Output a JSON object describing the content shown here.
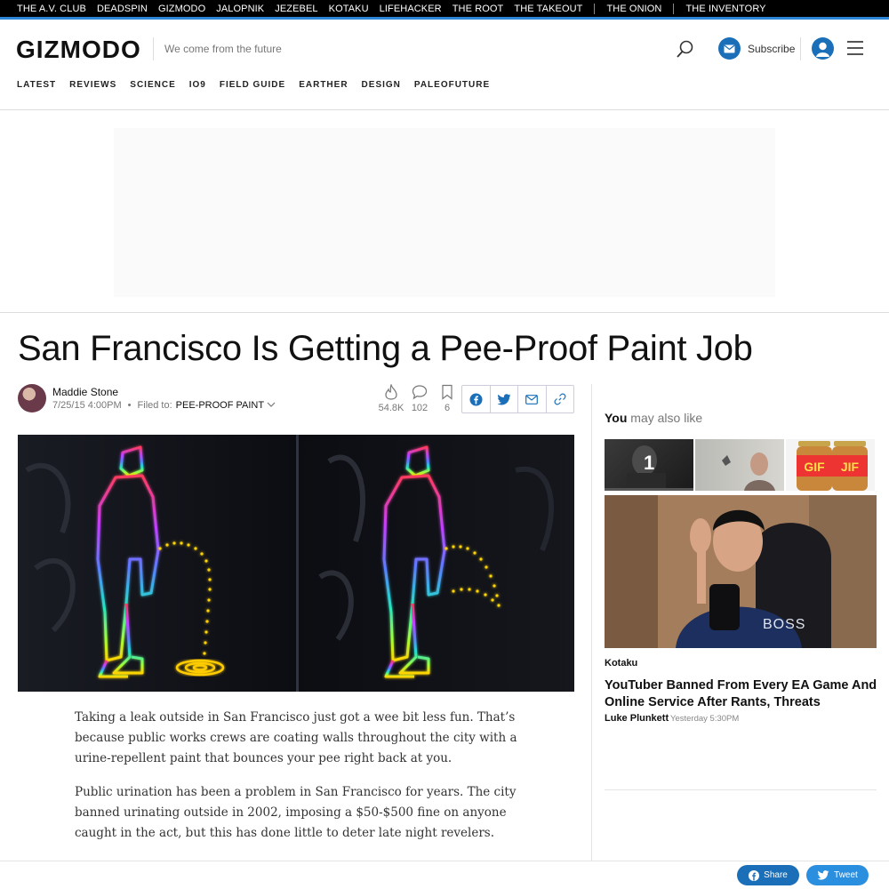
{
  "network": {
    "sites": [
      "THE A.V. CLUB",
      "DEADSPIN",
      "GIZMODO",
      "JALOPNIK",
      "JEZEBEL",
      "KOTAKU",
      "LIFEHACKER",
      "THE ROOT",
      "THE TAKEOUT"
    ],
    "extra": [
      "THE ONION",
      "THE INVENTORY"
    ]
  },
  "header": {
    "logo": "GIZMODO",
    "tagline": "We come from the future",
    "subscribe_label": "Subscribe",
    "nav": [
      "LATEST",
      "REVIEWS",
      "SCIENCE",
      "IO9",
      "FIELD GUIDE",
      "EARTHER",
      "DESIGN",
      "PALEOFUTURE"
    ]
  },
  "article": {
    "headline": "San Francisco Is Getting a Pee-Proof Paint Job",
    "author": "Maddie Stone",
    "date": "7/25/15 4:00PM",
    "filed_prefix": "Filed to:",
    "filed_tag": "PEE-PROOF PAINT",
    "stats": {
      "views": "54.8K",
      "comments": "102",
      "saves": "6"
    },
    "paragraphs": [
      "Taking a leak outside in San Francisco just got a wee bit less fun. That’s because public works crews are coating walls throughout the city with a urine-repellent paint that bounces your pee right back at you.",
      "Public urination has been a problem in San Francisco for years. The city banned urinating outside in 2002, imposing a $50-$500 fine on anyone caught in the act, but this has done little to deter late night revelers."
    ]
  },
  "sidebar": {
    "title_bold": "You",
    "title_rest": " may also like",
    "active_number": "1",
    "source": "Kotaku",
    "story_title": "YouTuber Banned From Every EA Game And Online Service After Rants, Threats",
    "story_author": "Luke Plunkett",
    "story_time": "Yesterday 5:30PM"
  },
  "footer": {
    "share_label": "Share",
    "tweet_label": "Tweet"
  },
  "colors": {
    "accent": "#2c85d6",
    "brand_blue": "#1a6fb8",
    "facebook": "#1877f2",
    "twitter": "#1da1f2"
  }
}
